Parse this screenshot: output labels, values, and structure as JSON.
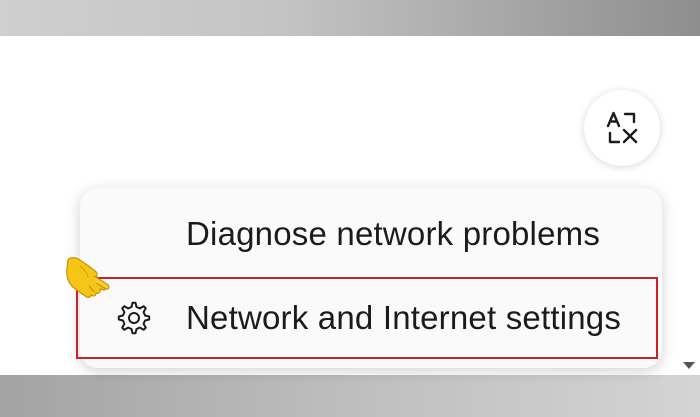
{
  "context_menu": {
    "items": [
      {
        "label": "Diagnose network problems",
        "icon": ""
      },
      {
        "label": "Network and Internet settings",
        "icon": "gear-icon"
      }
    ]
  },
  "translate_button": {
    "icon": "translate-icon"
  },
  "highlight": {
    "color": "#c8212c"
  },
  "pointer": {
    "icon": "pointing-hand-icon",
    "color": "#f5c518"
  }
}
